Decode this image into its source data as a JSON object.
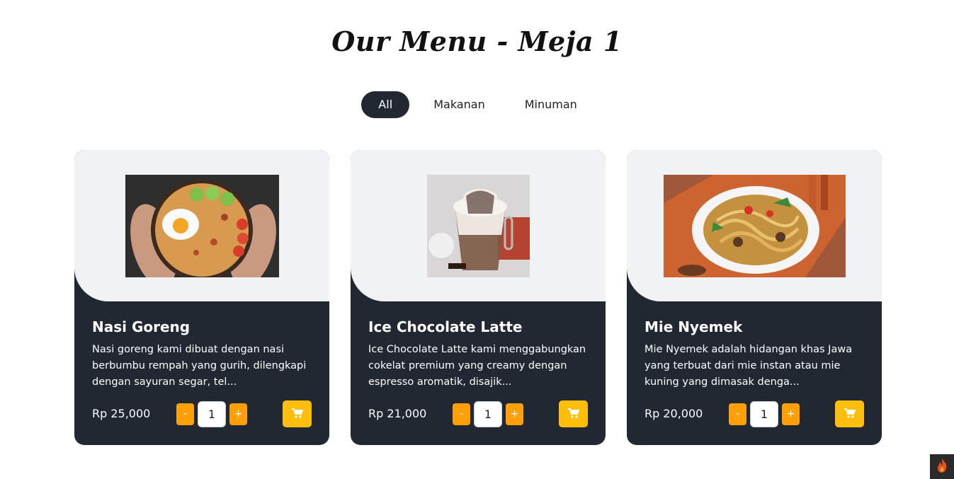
{
  "header": {
    "title": "Our Menu - Meja 1"
  },
  "filters": [
    {
      "label": "All",
      "active": true
    },
    {
      "label": "Makanan",
      "active": false
    },
    {
      "label": "Minuman",
      "active": false
    }
  ],
  "cards": [
    {
      "title": "Nasi Goreng",
      "description": "Nasi goreng kami dibuat dengan nasi berbumbu rempah yang gurih, dilengkapi dengan sayuran segar, tel...",
      "price": "Rp 25,000",
      "minus_label": "-",
      "plus_label": "+",
      "quantity": "1"
    },
    {
      "title": "Ice Chocolate Latte",
      "description": "Ice Chocolate Latte kami menggabungkan cokelat premium yang creamy dengan espresso aromatik, disajik...",
      "price": "Rp 21,000",
      "minus_label": "-",
      "plus_label": "+",
      "quantity": "1"
    },
    {
      "title": "Mie Nyemek",
      "description": "Mie Nyemek adalah hidangan khas Jawa yang terbuat dari mie instan atau mie kuning yang dimasak denga...",
      "price": "Rp 20,000",
      "minus_label": "-",
      "plus_label": "+",
      "quantity": "1"
    }
  ],
  "icons": {
    "cart": "cart-icon",
    "corner": "flame-icon"
  },
  "colors": {
    "dark": "#222831",
    "card_top": "#f1f2f3",
    "qty_button": "#ff9f0a",
    "cart_button": "#ffbe0b"
  }
}
